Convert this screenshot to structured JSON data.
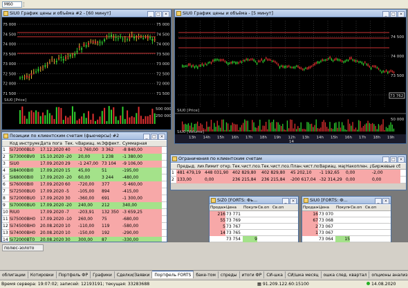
{
  "toolbar": {
    "combo": "M60"
  },
  "chart1": {
    "title": "SiU0 График цены и объёма #2 - [60 минут]",
    "price_label": "SiU0 [Price]",
    "y_ticks": [
      "75 000",
      "74 500",
      "74 000",
      "73 500",
      "73 000",
      "72 500",
      "72 000",
      "71 500"
    ],
    "r_ticks": [
      "75 000",
      "74 500",
      "74 000",
      "73 500",
      "73 000",
      "72 500",
      "72 000",
      "71 500"
    ],
    "vol_ticks": [
      "500 000",
      "250 000"
    ]
  },
  "chart2": {
    "title": "SiU0 График цены и объёма - [5 минут]",
    "price_label": "SiU0 [Price]",
    "vol_label": "SiU0 [Volume]",
    "r_ticks": [
      "74 500",
      "74 000",
      "73 500",
      "73 000"
    ],
    "last": "73 762",
    "vol_ticks": [
      "50 000"
    ],
    "x_labels": [
      "13h",
      "14h",
      "15h",
      "16h",
      "17h",
      "18h",
      "19h",
      "12h",
      "13h",
      "14h",
      "15h",
      "16h",
      "17h",
      "18h",
      "19h"
    ],
    "x_date": "14"
  },
  "positions": {
    "title": "Позиции по клиентским счетам (фьючерсы) #2",
    "headers": [
      "",
      "Код инструмента",
      "Дата пога",
      "Тек. чист.",
      "Вариац. маржа",
      "Эффект. цена",
      "Суммарная"
    ],
    "rows": [
      [
        "1",
        "Si72000BL0",
        "17.12.2020",
        "40",
        "-1 760,00",
        "3 362",
        "-8 840,00",
        "s"
      ],
      [
        "2",
        "Si73000BV0",
        "15.10.2020",
        "-20",
        "20,00",
        "1 238",
        "-1 380,00",
        "b"
      ],
      [
        "3",
        "SiU0",
        "17.09.2020",
        "29",
        "-1 247,00",
        "73 104",
        "-9 106,00",
        "s"
      ],
      [
        "4",
        "Si84000BI0",
        "17.09.2020",
        "15",
        "45,00",
        "51",
        "-195,00",
        "b"
      ],
      [
        "5",
        "Si68000BI0",
        "17.09.2020",
        "-20",
        "60,00",
        "3 244",
        "-480,00",
        "b"
      ],
      [
        "6",
        "Si76000BI0",
        "17.09.2020",
        "60",
        "-720,00",
        "377",
        "-5 460,00",
        "s"
      ],
      [
        "7",
        "Si72500BU0",
        "17.09.2020",
        "-5",
        "-105,00",
        "894",
        "-415,00",
        "s"
      ],
      [
        "8",
        "Si72000BU0",
        "17.09.2020",
        "30",
        "-360,00",
        "691",
        "-1 300,00",
        "s"
      ],
      [
        "9",
        "Si70000BU0",
        "17.09.2020",
        "-20",
        "240,00",
        "212",
        "340,00",
        "b"
      ],
      [
        "10",
        "RIU0",
        "17.09.2020",
        "-7",
        "-203,91",
        "132 350",
        "-3 659,25",
        "s"
      ],
      [
        "11",
        "Si75000BH0",
        "17.09.2020",
        "-10",
        "260,00",
        "75",
        "-680,00",
        "s"
      ],
      [
        "12",
        "Si74500BH0",
        "20.08.2020",
        "10",
        "-110,00",
        "119",
        "-580,00",
        "s"
      ],
      [
        "13",
        "Si74000BH0",
        "20.08.2020",
        "10",
        "-150,00",
        "192",
        "-290,00",
        "s"
      ],
      [
        "14",
        "Si72000BT0",
        "20.08.2020",
        "30",
        "300,00",
        "87",
        "-330,00",
        "b"
      ],
      [
        "15",
        "RI135000BH0",
        "20.08.2020",
        "4",
        "116,52",
        "600",
        "889,30",
        "b"
      ],
      [
        "16",
        "RI130000BH0",
        "20.08.2020",
        "-1",
        "-58,26",
        "3 170",
        "-1 266,34",
        "s"
      ]
    ]
  },
  "limits": {
    "title": "Ограничения по клиентским счетам",
    "headers": [
      "",
      "Предыд. лимит",
      "Лимит откр. п",
      "Тек.чист.поз.",
      "Тек.чист.поз. (",
      "План.чист.поз.",
      "Вариац. маржа",
      "Накоплен. д",
      "Биржевые сб"
    ],
    "rows": [
      [
        "1",
        "481 479,19",
        "448 031,90",
        "402 829,80",
        "402 829,80",
        "45 202,10",
        "-1 192,65",
        "0,00",
        "-2,00"
      ],
      [
        "2",
        "133,00",
        "0,00",
        "236 215,84",
        "236 215,84",
        "-200 617,04",
        "-32 314,29",
        "0,00",
        "0,00"
      ]
    ]
  },
  "dom1": {
    "title": "SiZ0 [FORTS: Фь...",
    "headers": [
      "Продаж",
      "Цена",
      "Покупка",
      "Св.оп",
      "Св.оп"
    ],
    "rows": [
      [
        "216",
        "73 771",
        "",
        "",
        ""
      ],
      [
        "55",
        "73 769",
        "",
        "",
        ""
      ],
      [
        "5",
        "73 767",
        "",
        "",
        ""
      ],
      [
        "14",
        "73 765",
        "",
        "",
        ""
      ],
      [
        "",
        "73 754",
        "9",
        "",
        ""
      ],
      [
        "",
        "73 745",
        "7",
        "",
        ""
      ],
      [
        "",
        "73 737",
        "60",
        "",
        ""
      ]
    ]
  },
  "dom2": {
    "title": "SiU0 [FORTS: Ф...",
    "headers": [
      "Продаж",
      "Цена",
      "Покупка",
      "Св.оп",
      "Св.оп"
    ],
    "rows": [
      [
        "16",
        "73 070",
        "",
        "",
        ""
      ],
      [
        "67",
        "73 068",
        "",
        "",
        ""
      ],
      [
        "2",
        "73 067",
        "",
        "",
        ""
      ],
      [
        "1",
        "73 067",
        "",
        "",
        ""
      ],
      [
        "",
        "73 064",
        "15",
        "",
        ""
      ],
      [
        "",
        "73 063",
        "18",
        "",
        ""
      ],
      [
        "",
        "73 062",
        "22",
        "",
        ""
      ]
    ]
  },
  "note": "полюс-золото",
  "tabs": [
    "облигации",
    "Котировки",
    "Портфель ФР",
    "Графики",
    "Сделки/Заявки",
    "Портфель FORTS",
    "баке-том",
    "спреды",
    "итоги ФР",
    "СИ-шка",
    "СИ/шка месяц",
    "ошка след. квартал",
    "опционы анализ",
    "опционы РТС",
    "нефть-"
  ],
  "status": {
    "server": "Время сервера: 19:07:02; записей: 12193191; текущая: 33283688",
    "ip": "91.209.122.60:15100",
    "date": "14.08.2020"
  }
}
